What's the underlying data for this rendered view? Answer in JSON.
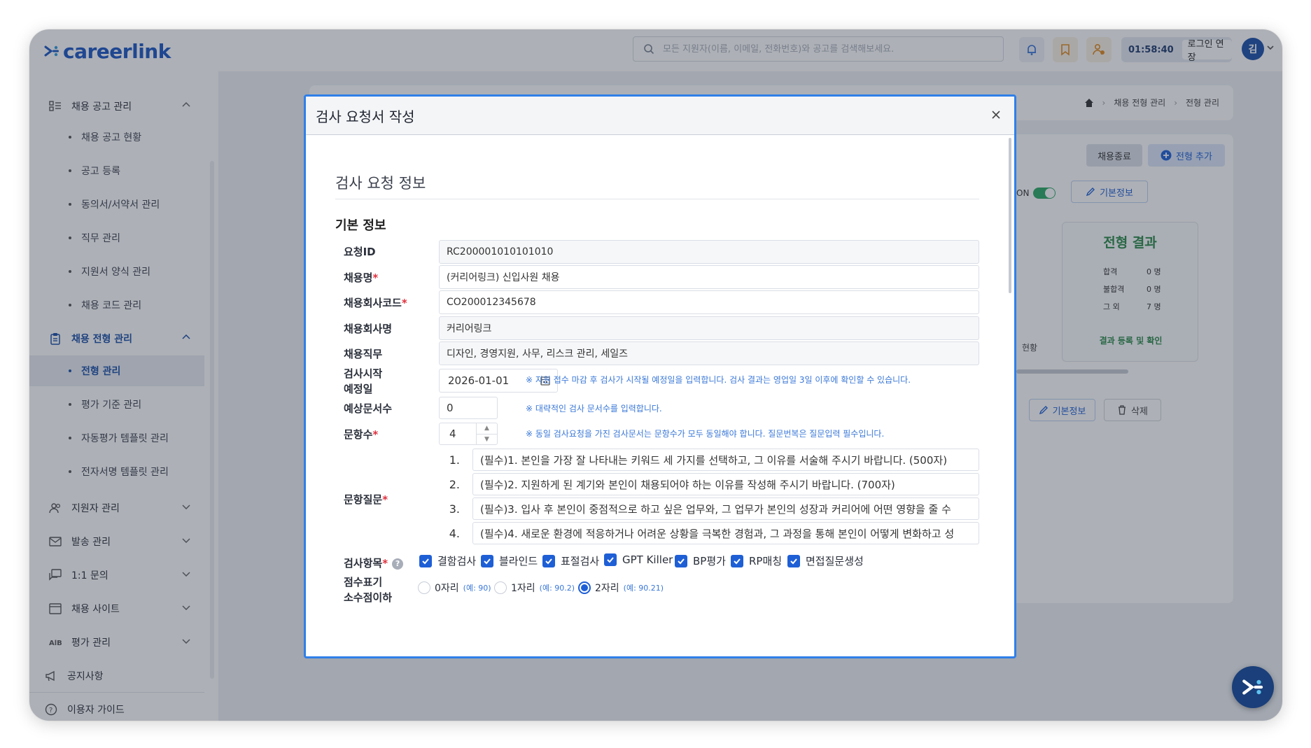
{
  "app": {
    "logo_text": "careerlink",
    "search_placeholder": "모든 지원자(이름, 이메일, 전화번호)와 공고를 검색해보세요.",
    "timer": "01:58:40",
    "extend_label": "로그인 연장",
    "avatar_initial": "김",
    "icons": [
      "bell-icon",
      "bookmark-icon",
      "user-switch-icon"
    ]
  },
  "sidebar": {
    "groups": [
      {
        "label": "채용 공고 관리",
        "icon": "list-icon"
      },
      {
        "label": "채용 전형 관리",
        "icon": "clipboard-icon"
      },
      {
        "label": "지원자 관리",
        "icon": "users-icon"
      },
      {
        "label": "발송 관리",
        "icon": "mail-icon"
      },
      {
        "label": "1:1 문의",
        "icon": "chat-icon"
      },
      {
        "label": "채용 사이트",
        "icon": "window-icon"
      },
      {
        "label": "평가 관리",
        "icon": "ab-icon"
      }
    ],
    "sub_recruit": [
      "채용 공고 현황",
      "공고 등록",
      "동의서/서약서 관리",
      "직무 관리",
      "지원서 양식 관리",
      "채용 코드 관리"
    ],
    "sub_process": [
      "전형 관리",
      "평가 기준 관리",
      "자동평가 템플릿 관리",
      "전자서명 템플릿 관리"
    ],
    "bottom": [
      {
        "label": "공지사항",
        "icon": "megaphone-icon"
      },
      {
        "label": "이용자 가이드",
        "icon": "help-icon"
      }
    ]
  },
  "background": {
    "breadcrumb": [
      "채용 전형 관리",
      "전형 관리"
    ],
    "end_button": "채용종료",
    "add_stage_button": "전형 추가",
    "toggle_label": "ON",
    "basic_info_button": "기본정보",
    "delete_button": "삭제",
    "result_card": {
      "title": "전형 결과",
      "rows": [
        {
          "label": "합격",
          "value": "0 명"
        },
        {
          "label": "불합격",
          "value": "0 명"
        },
        {
          "label": "그 외",
          "value": "7 명"
        }
      ],
      "link": "결과 등록 및 확인"
    },
    "partial_left_text": "현황"
  },
  "modal": {
    "title": "검사 요청서 작성",
    "section_title": "검사 요청 정보",
    "sub_title": "기본 정보",
    "fields": {
      "request_id": {
        "label": "요청ID",
        "value": "RC200001010101010"
      },
      "recruit_name": {
        "label": "채용명",
        "value": "(커리어링크) 신입사원 채용"
      },
      "company_code": {
        "label": "채용회사코드",
        "value": "CO200012345678"
      },
      "company_name": {
        "label": "채용회사명",
        "value": "커리어링크"
      },
      "job": {
        "label": "채용직무",
        "value": "디자인, 경영지원, 사무, 리스크 관리, 세일즈"
      },
      "start_date": {
        "label_1": "검사시작",
        "label_2": "예정일",
        "value": "2026-01-01",
        "hint": "※ 지원 접수 마감 후 검사가 시작될 예정일을 입력합니다. 검사 결과는 영업일 3일 이후에 확인할 수 있습니다."
      },
      "doc_count": {
        "label": "예상문서수",
        "value": "0",
        "hint": "※ 대략적인 검사 문서수를 입력합니다."
      },
      "question_count": {
        "label": "문항수",
        "value": "4",
        "hint": "※ 동일 검사요청을 가진 검사문서는 문항수가 모두 동일해야 합니다. 질문번복은 질문입력 필수입니다."
      },
      "questions": {
        "label": "문항질문",
        "items": [
          {
            "num": "1.",
            "text": "(필수)1. 본인을 가장 잘 나타내는 키워드 세 가지를 선택하고, 그 이유를 서술해 주시기 바랍니다. (500자)"
          },
          {
            "num": "2.",
            "text": "(필수)2. 지원하게 된 계기와 본인이 채용되어야 하는 이유를 작성해 주시기 바랍니다. (700자)"
          },
          {
            "num": "3.",
            "text": "(필수)3. 입사 후 본인이 중점적으로 하고 싶은 업무와, 그 업무가 본인의 성장과 커리어에 어떤 영향을 줄 수"
          },
          {
            "num": "4.",
            "text": "(필수)4. 새로운 환경에 적응하거나 어려운 상황을 극복한 경험과, 그 과정을 통해 본인이 어떻게 변화하고 성"
          }
        ]
      },
      "test_items": {
        "label": "검사항목",
        "options": [
          "결함검사",
          "블라인드",
          "표절검사",
          "GPT Killer",
          "BP평가",
          "RP매칭",
          "면접질문생성"
        ]
      },
      "score_format": {
        "label_1": "점수표기",
        "label_2": "소수점이하",
        "options": [
          {
            "label": "0자리",
            "example": "(예: 90)",
            "selected": false
          },
          {
            "label": "1자리",
            "example": "(예: 90.2)",
            "selected": false
          },
          {
            "label": "2자리",
            "example": "(예: 90.21)",
            "selected": true
          }
        ]
      }
    }
  },
  "colors": {
    "brand": "#1a56c4",
    "accent": "#1e5fd6",
    "hint": "#3a78d8",
    "required": "#e0313d"
  }
}
